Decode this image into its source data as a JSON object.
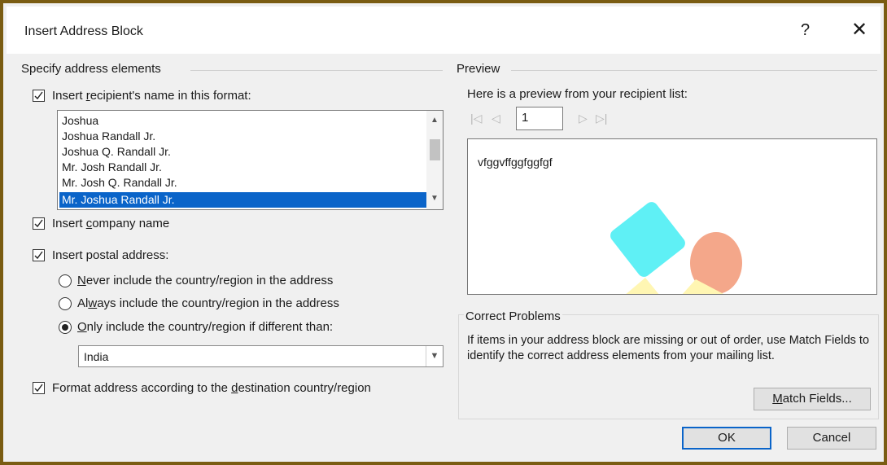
{
  "window": {
    "title": "Insert Address Block",
    "help_label": "?",
    "close_label": "✕"
  },
  "address_elements": {
    "group_label": "Specify address elements",
    "recipient_name": {
      "checked": true,
      "label_pre": "Insert ",
      "label_accel": "r",
      "label_post": "ecipient's name in this format:",
      "formats": [
        "Joshua",
        "Joshua Randall Jr.",
        "Joshua Q. Randall Jr.",
        "Mr. Josh Randall Jr.",
        "Mr. Josh Q. Randall Jr.",
        "Mr. Joshua Randall Jr."
      ],
      "selected_index": 5
    },
    "company": {
      "checked": true,
      "label_pre": "Insert ",
      "label_accel": "c",
      "label_post": "ompany name"
    },
    "postal": {
      "checked": true,
      "label_pre": "Insert postal address:",
      "options": [
        {
          "accel": "N",
          "rest": "ever include the country/region in the address",
          "selected": false
        },
        {
          "pre": "Al",
          "accel": "w",
          "rest": "ays include the country/region in the address",
          "selected": true
        },
        {
          "accel": "O",
          "rest": "nly include the country/region if different than:",
          "selected": true
        }
      ],
      "country_value": "India"
    },
    "format_by_country": {
      "checked": true,
      "label_pre": "Format address according to the ",
      "label_accel": "d",
      "label_post": "estination country/region"
    }
  },
  "preview": {
    "group_label": "Preview",
    "intro": "Here is a preview from your recipient list:",
    "record_number": "1",
    "preview_text": "vfggvffggfggfgf"
  },
  "problems": {
    "group_label": "Correct Problems",
    "text": "If items in your address block are missing or out of order, use Match Fields to identify the correct address elements from your mailing list.",
    "match_fields_accel": "M",
    "match_fields_rest": "atch Fields..."
  },
  "buttons": {
    "ok": "OK",
    "cancel": "Cancel"
  },
  "icons": {
    "checkmark": "checkmark-icon",
    "first_record": "first-record-icon",
    "prev_record": "previous-record-icon",
    "next_record": "next-record-icon",
    "last_record": "last-record-icon"
  },
  "colors": {
    "selection": "#0a64c9",
    "frame": "#7a5c12",
    "watermark_cyan": "#5ff0f5",
    "watermark_salmon": "#f4a78a",
    "watermark_yellow": "#fff6b3"
  }
}
